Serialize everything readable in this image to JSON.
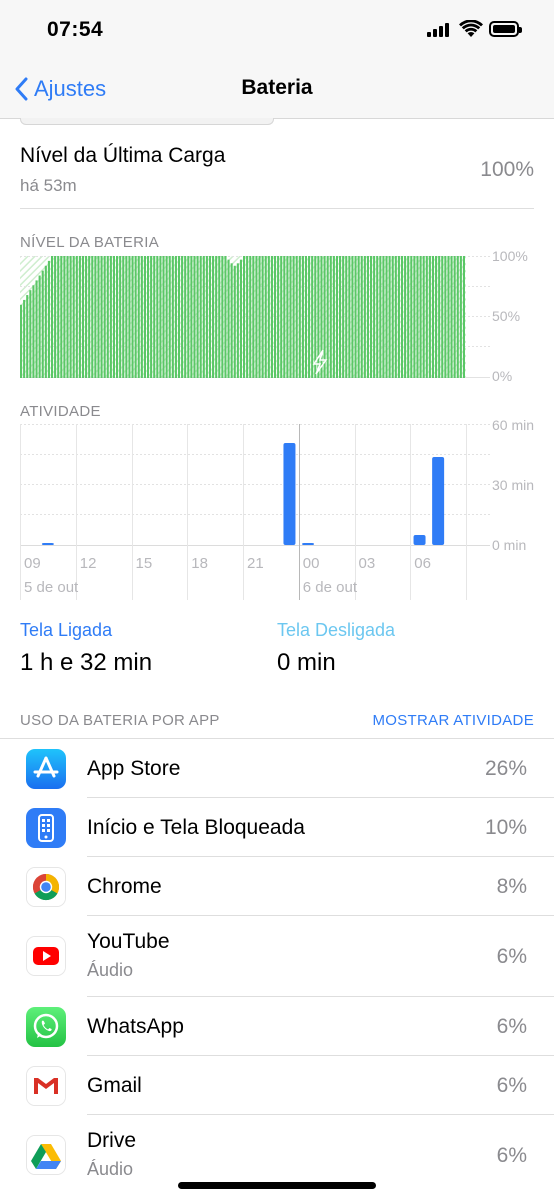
{
  "status_bar": {
    "time": "07:54"
  },
  "nav": {
    "back_label": "Ajustes",
    "title": "Bateria"
  },
  "last_charge": {
    "title": "Nível da Última Carga",
    "subtitle": "há 53m",
    "value": "100%"
  },
  "battery_level_section": {
    "label": "NÍVEL DA BATERIA"
  },
  "activity_section": {
    "label": "ATIVIDADE"
  },
  "chart_data": [
    {
      "type": "bar",
      "name": "battery-level",
      "title": "NÍVEL DA BATERIA",
      "ylim": [
        0,
        100
      ],
      "y_ticks": [
        "100%",
        "50%",
        "0%"
      ],
      "values": [
        60,
        64,
        68,
        72,
        76,
        80,
        84,
        88,
        92,
        96,
        100,
        100,
        100,
        100,
        100,
        100,
        100,
        100,
        100,
        100,
        100,
        100,
        100,
        100,
        100,
        100,
        100,
        100,
        100,
        100,
        100,
        100,
        100,
        100,
        100,
        100,
        100,
        100,
        100,
        100,
        100,
        100,
        100,
        100,
        100,
        100,
        100,
        100,
        100,
        100,
        100,
        100,
        100,
        100,
        100,
        100,
        100,
        100,
        100,
        100,
        100,
        100,
        100,
        100,
        100,
        100,
        100,
        97,
        94,
        92,
        94,
        97,
        100,
        100,
        100,
        100,
        100,
        100,
        100,
        100,
        100,
        100,
        100,
        100,
        100,
        100,
        100,
        100,
        100,
        100,
        100,
        100,
        100,
        100,
        100,
        100,
        100,
        100,
        100,
        100,
        100,
        100,
        100,
        100,
        100,
        100,
        100,
        100,
        100,
        100,
        100,
        100,
        100,
        100,
        100,
        100,
        100,
        100,
        100,
        100,
        100,
        100,
        100,
        100,
        100,
        100,
        100,
        100,
        100,
        100,
        100,
        100,
        100,
        100,
        100,
        100,
        100,
        100,
        100,
        100,
        100,
        100,
        100,
        100
      ],
      "color": "#5ac766",
      "charging_icon": "bolt-icon"
    },
    {
      "type": "bar",
      "name": "activity",
      "title": "ATIVIDADE",
      "ylim": [
        0,
        60
      ],
      "y_ticks": [
        "60 min",
        "30 min",
        "0 min"
      ],
      "x_ticks": [
        "09",
        "12",
        "15",
        "18",
        "21",
        "00",
        "03",
        "06"
      ],
      "date_labels": [
        "5 de out",
        "6 de out"
      ],
      "bars": [
        {
          "hour": "10",
          "minutes": 1
        },
        {
          "hour": "23",
          "minutes": 51
        },
        {
          "hour": "00",
          "minutes": 1
        },
        {
          "hour": "06",
          "minutes": 5
        },
        {
          "hour": "07",
          "minutes": 44
        }
      ],
      "color": "#2f7cf6"
    }
  ],
  "screen_stats": {
    "on_label": "Tela Ligada",
    "on_value": "1 h e 32 min",
    "off_label": "Tela Desligada",
    "off_value": "0 min"
  },
  "usage": {
    "header_left": "USO DA BATERIA POR APP",
    "header_right": "MOSTRAR ATIVIDADE",
    "apps": [
      {
        "name": "App Store",
        "sub": "",
        "percent": "26%",
        "icon": "app-store-icon"
      },
      {
        "name": "Início e Tela Bloqueada",
        "sub": "",
        "percent": "10%",
        "icon": "home-lock-screen-icon"
      },
      {
        "name": "Chrome",
        "sub": "",
        "percent": "8%",
        "icon": "chrome-icon"
      },
      {
        "name": "YouTube",
        "sub": "Áudio",
        "percent": "6%",
        "icon": "youtube-icon"
      },
      {
        "name": "WhatsApp",
        "sub": "",
        "percent": "6%",
        "icon": "whatsapp-icon"
      },
      {
        "name": "Gmail",
        "sub": "",
        "percent": "6%",
        "icon": "gmail-icon"
      },
      {
        "name": "Drive",
        "sub": "Áudio",
        "percent": "6%",
        "icon": "drive-icon"
      }
    ]
  }
}
